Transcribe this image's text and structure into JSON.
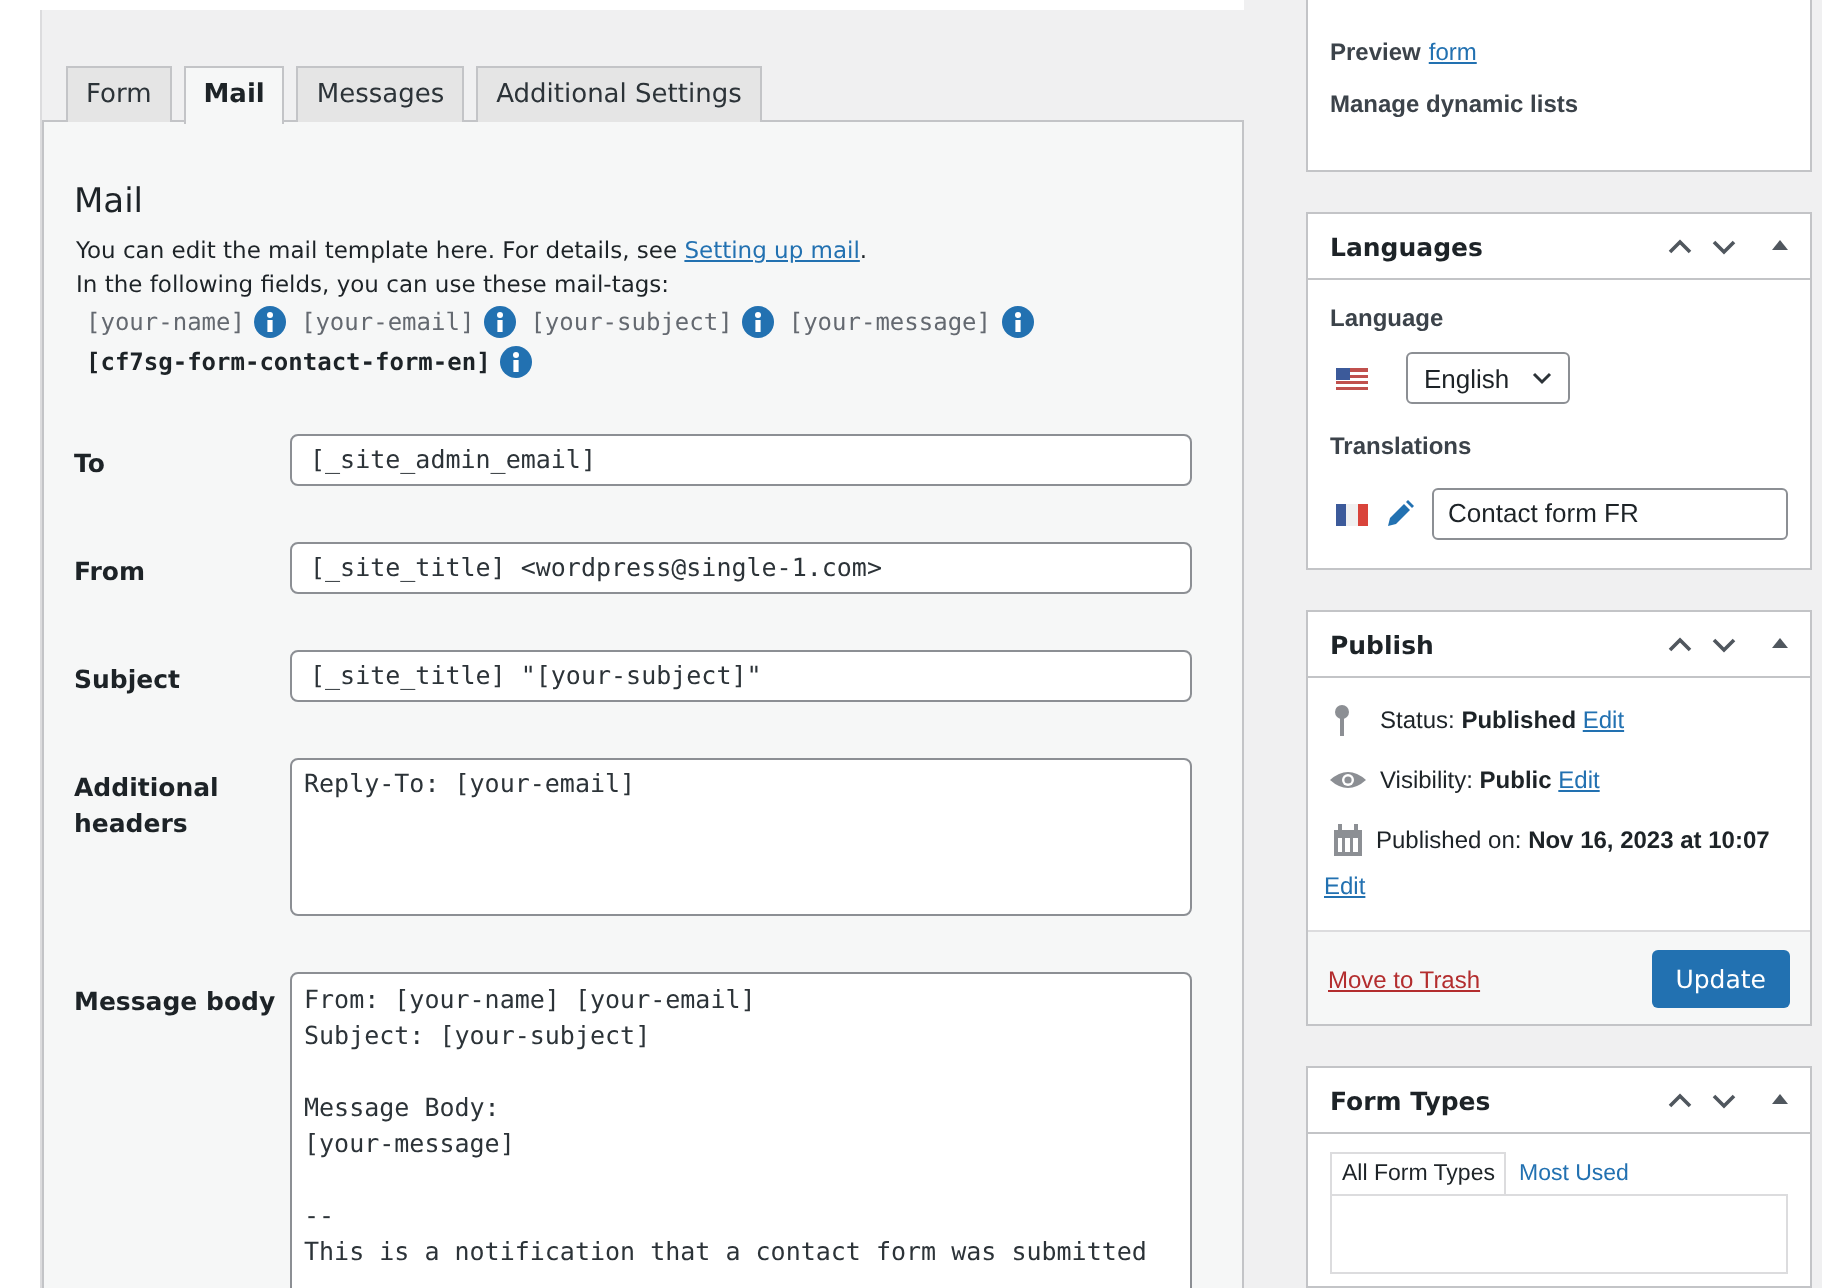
{
  "tabs": [
    {
      "label": "Form",
      "selected": false
    },
    {
      "label": "Mail",
      "selected": true
    },
    {
      "label": "Messages",
      "selected": false
    },
    {
      "label": "Additional Settings",
      "selected": false
    }
  ],
  "mail": {
    "heading": "Mail",
    "intro": "You can edit the mail template here. For details, see ",
    "intro_link": "Setting up mail",
    "intro_end": ".",
    "tags_intro": "In the following fields, you can use these mail-tags:",
    "mail_tags": [
      {
        "text": "[your-name]",
        "bold": false
      },
      {
        "text": "[your-email]",
        "bold": false
      },
      {
        "text": "[your-subject]",
        "bold": false
      },
      {
        "text": "[your-message]",
        "bold": false
      },
      {
        "text": "[cf7sg-form-contact-form-en]",
        "bold": true
      }
    ],
    "fields": [
      {
        "label": "To",
        "kind": "input",
        "value": "[_site_admin_email]"
      },
      {
        "label": "From",
        "kind": "input",
        "value": "[_site_title] <wordpress@single-1.com>"
      },
      {
        "label": "Subject",
        "kind": "input",
        "value": "[_site_title] \"[your-subject]\""
      },
      {
        "label": "Additional headers",
        "kind": "textarea",
        "value": "Reply-To: [your-email]"
      },
      {
        "label": "Message body",
        "kind": "body",
        "value": "From: [your-name] [your-email]\nSubject: [your-subject]\n\nMessage Body:\n[your-message]\n\n--\nThis is a notification that a contact form was submitted"
      }
    ]
  },
  "sidebar": {
    "info": {
      "preview_label": "Preview",
      "preview_link": "form",
      "manage": "Manage dynamic lists"
    },
    "languages": {
      "title": "Languages",
      "language_label": "Language",
      "language": "English",
      "translations_label": "Translations",
      "translation": "Contact form FR"
    },
    "publish": {
      "title": "Publish",
      "status": "Status: **Published**",
      "visibility": "Visibility: **Public**",
      "published_on": "Published on: **Nov 16, 2023 at 10:07**",
      "edit_links": [
        "Edit",
        "Edit",
        "Edit"
      ],
      "trash": "Move to Trash",
      "update": "Update"
    },
    "form_types": {
      "title": "Form Types",
      "tabs": [
        {
          "label": "All Form Types",
          "selected": true
        },
        {
          "label": "Most Used",
          "selected": false
        }
      ]
    }
  }
}
